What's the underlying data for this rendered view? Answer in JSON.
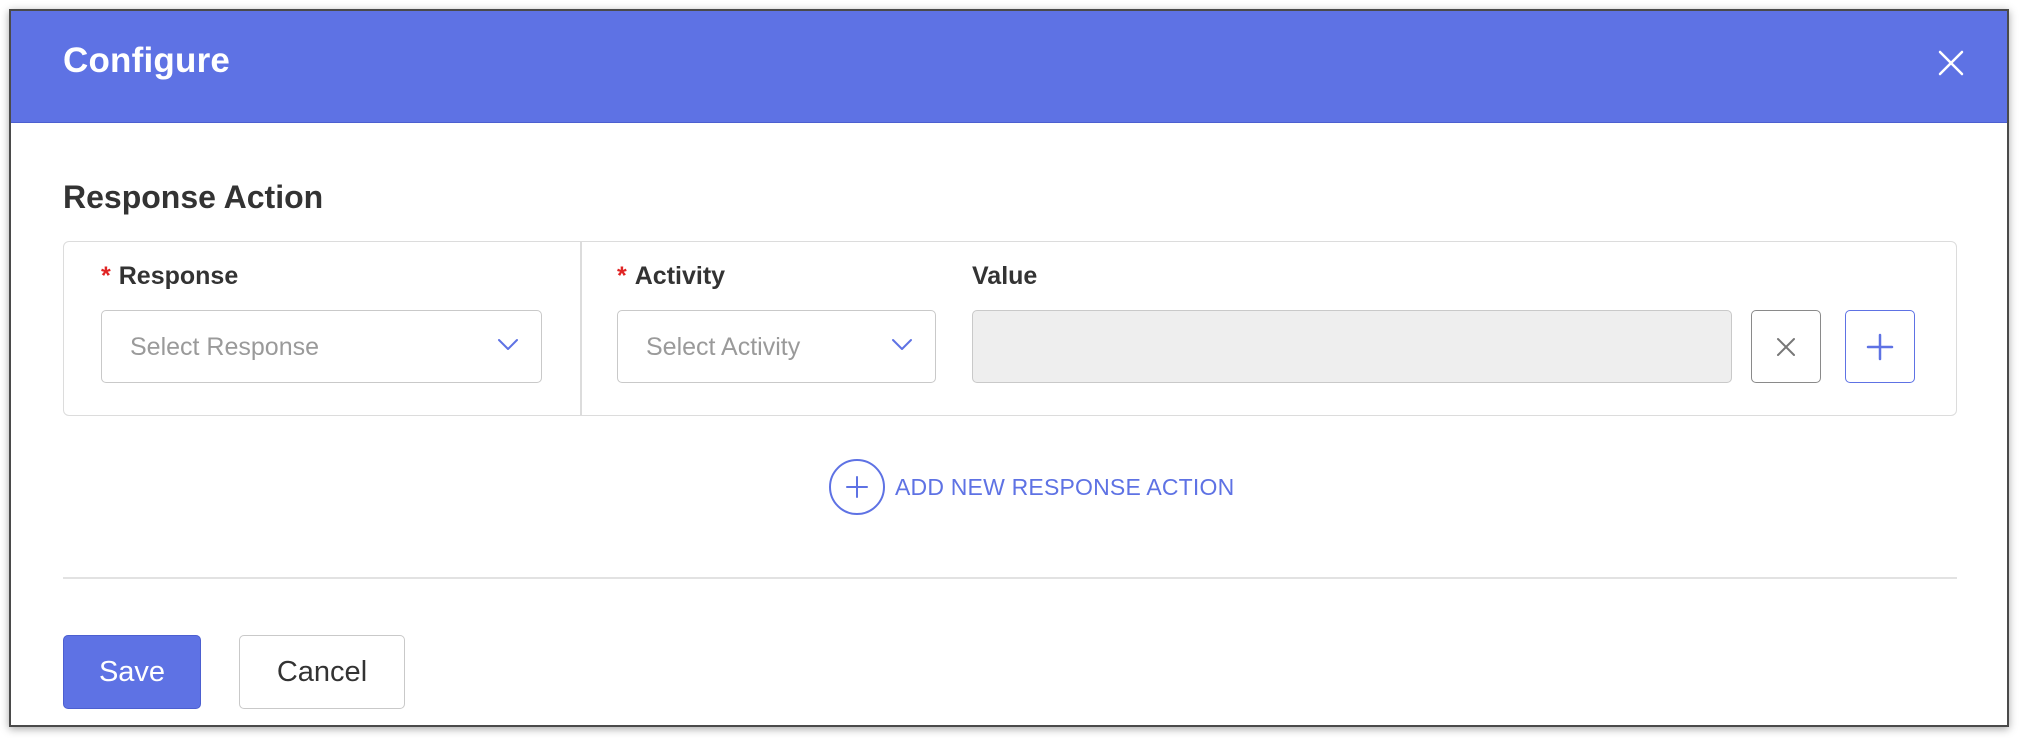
{
  "dialog": {
    "title": "Configure",
    "close_icon": "close-icon"
  },
  "section": {
    "title": "Response Action"
  },
  "fields": {
    "required_marker": "*",
    "response": {
      "label": "Response",
      "placeholder": "Select Response",
      "icon": "chevron-down-icon"
    },
    "activity": {
      "label": "Activity",
      "placeholder": "Select Activity",
      "icon": "chevron-down-icon"
    },
    "value": {
      "label": "Value",
      "value": "",
      "disabled": true
    }
  },
  "row_actions": {
    "remove_icon": "close-icon",
    "add_icon": "plus-icon"
  },
  "add_new": {
    "label": "ADD NEW RESPONSE ACTION",
    "icon": "plus-circle-icon"
  },
  "footer": {
    "save_label": "Save",
    "cancel_label": "Cancel"
  },
  "colors": {
    "primary": "#5e72e4",
    "required": "#e02424",
    "disabled_bg": "#eeeeee",
    "text": "#333333",
    "placeholder": "#9a9a9a"
  }
}
